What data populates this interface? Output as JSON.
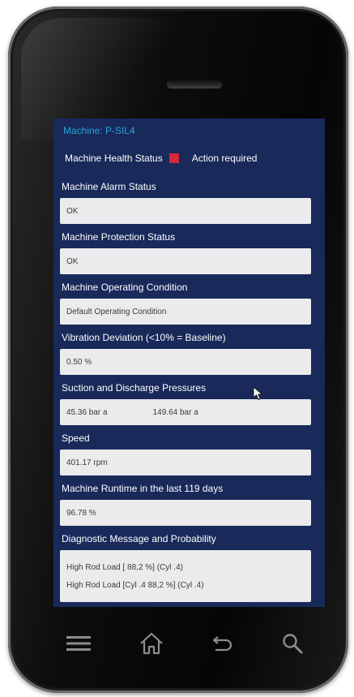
{
  "app": {
    "machine_label": "Machine: P-SIL4",
    "health": {
      "label": "Machine Health Status",
      "status_color": "#d2283a",
      "status_text": "Action required"
    }
  },
  "sections": [
    {
      "label": "Machine Alarm Status",
      "value": "OK"
    },
    {
      "label": "Machine Protection Status",
      "value": "OK"
    },
    {
      "label": "Machine Operating Condition",
      "value": "Default Operating Condition"
    },
    {
      "label": "Vibration Deviation (<10% = Baseline)",
      "value": "0.50 %"
    },
    {
      "label": "Suction and Discharge Pressures",
      "suction": "45.36 bar a",
      "discharge": "149.64 bar a"
    },
    {
      "label": "Speed",
      "value": "401.17 rpm"
    },
    {
      "label": "Machine Runtime in the last 119 days",
      "value": "96.78 %"
    },
    {
      "label": "Diagnostic Message and Probability",
      "line1": "High Rod Load [ 88,2 %] (Cyl .4)",
      "line2": "High Rod Load [Cyl .4 88,2 %] (Cyl .4)"
    }
  ],
  "nav": {
    "icons": [
      "menu-icon",
      "home-icon",
      "back-icon",
      "search-icon"
    ]
  }
}
